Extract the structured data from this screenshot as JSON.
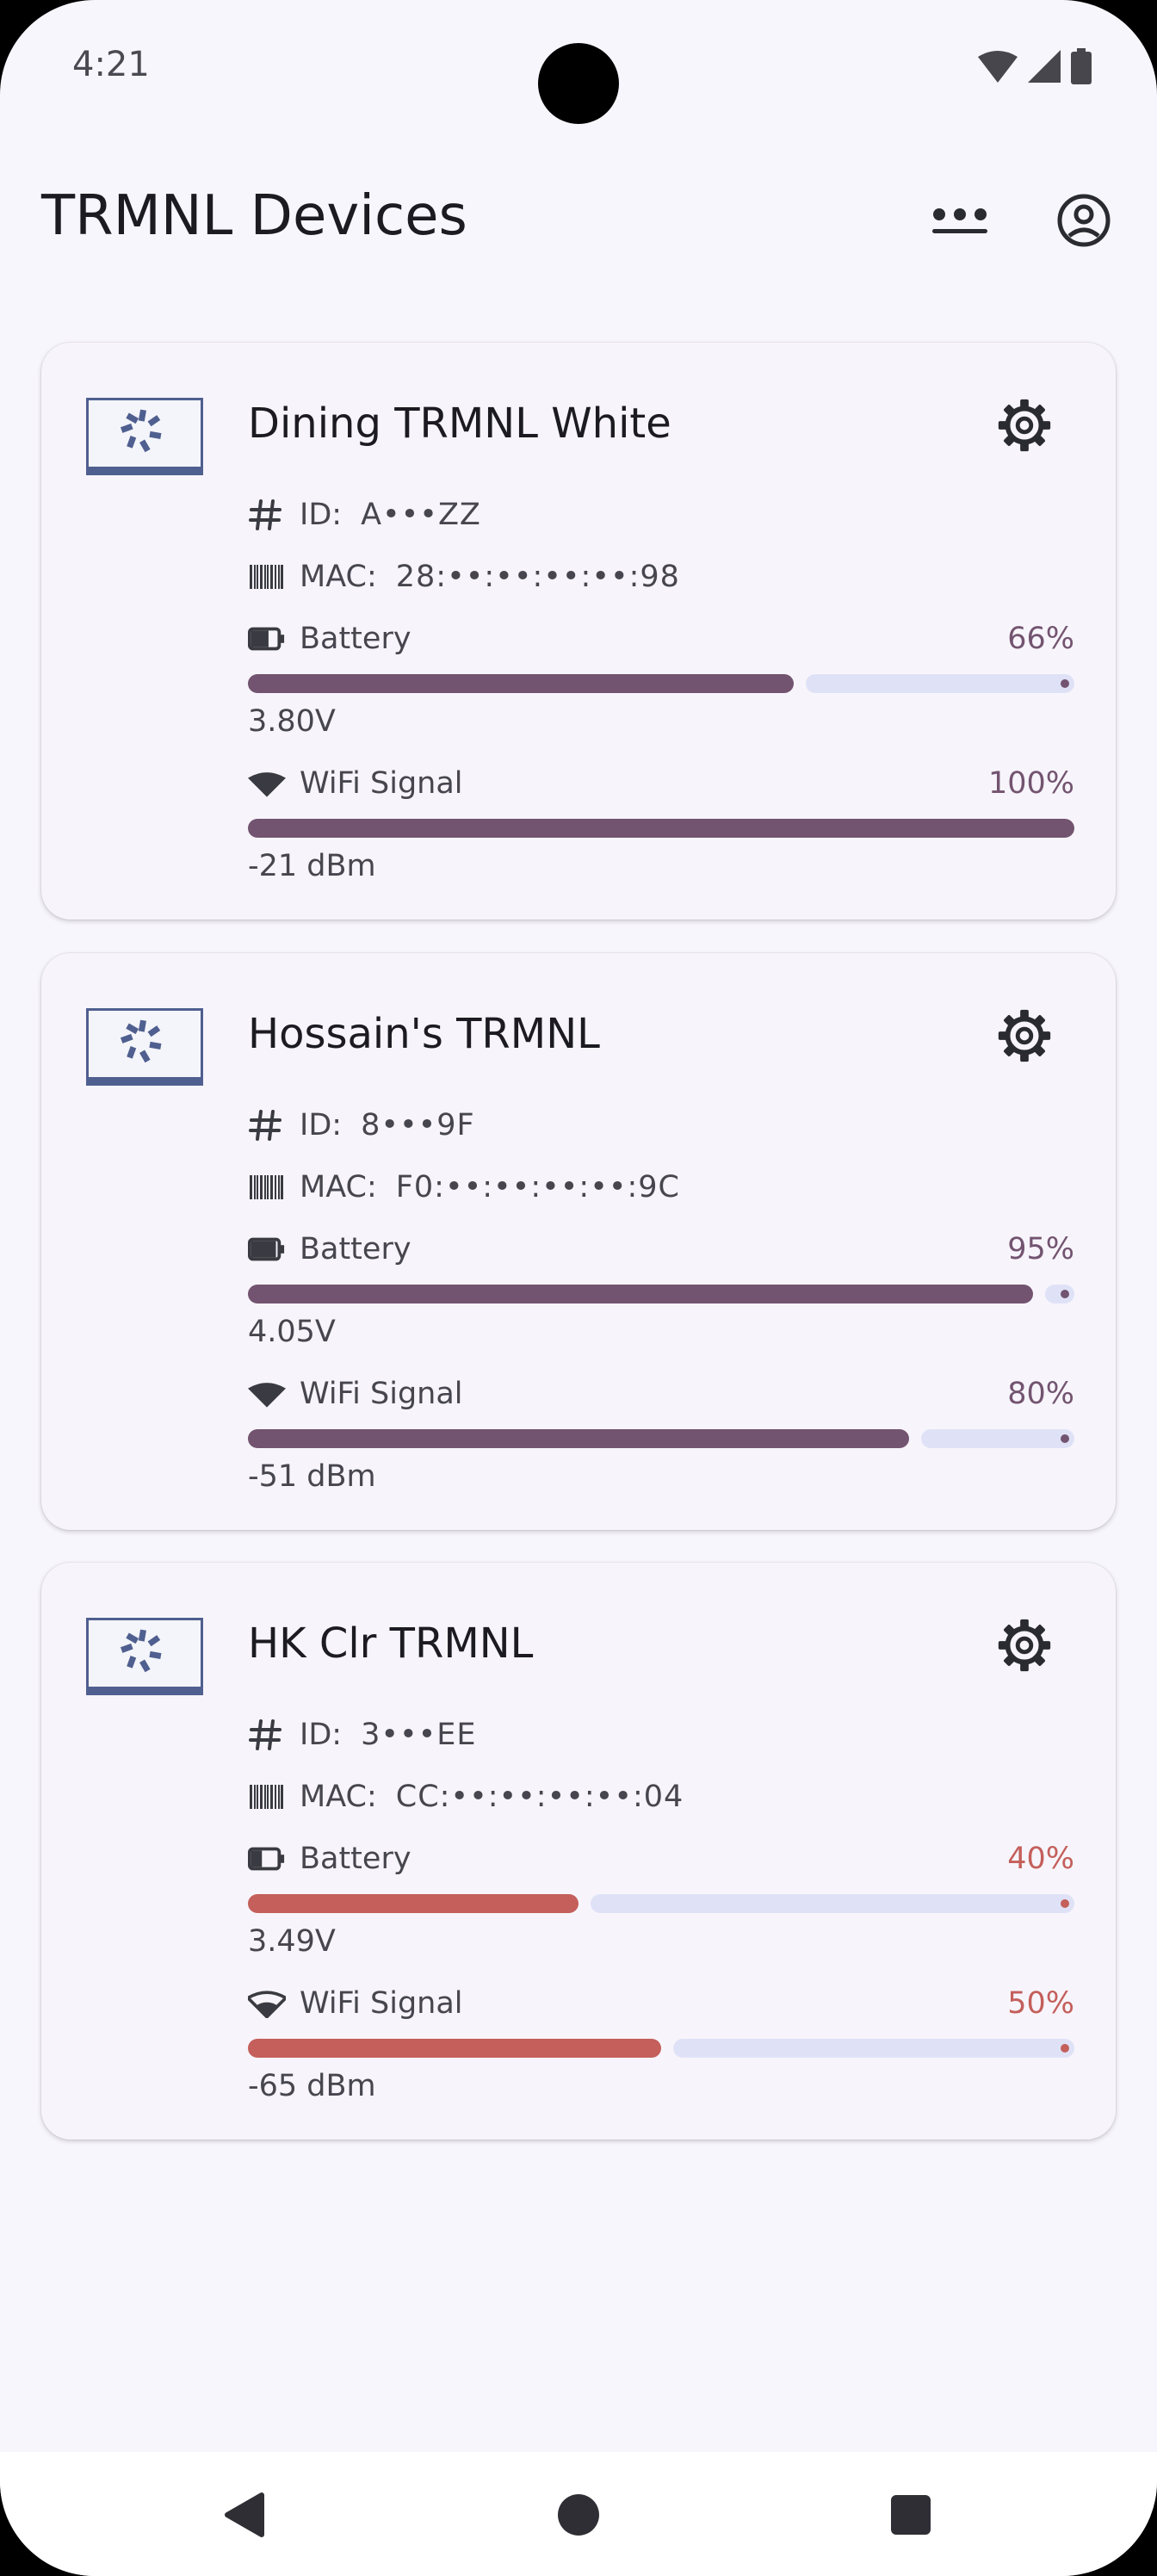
{
  "status_bar": {
    "time": "4:21"
  },
  "app_bar": {
    "title": "TRMNL Devices"
  },
  "colors": {
    "good": "#735470",
    "bad": "#c45f5b",
    "track": "#dfe2f7"
  },
  "labels": {
    "id": "ID:",
    "mac": "MAC:",
    "battery": "Battery",
    "wifi": "WiFi Signal"
  },
  "devices": [
    {
      "name": "Dining TRMNL White",
      "id": "A•••ZZ",
      "mac": "28:••:••:••:••:98",
      "battery_pct": "66%",
      "battery_value": 66,
      "voltage": "3.80V",
      "wifi_pct": "100%",
      "wifi_value": 100,
      "signal": "-21 dBm",
      "battery_status": "good",
      "wifi_status": "good",
      "battery_icon": "battery-half-icon",
      "wifi_icon": "wifi-full-icon"
    },
    {
      "name": "Hossain's TRMNL",
      "id": "8•••9F",
      "mac": "F0:••:••:••:••:9C",
      "battery_pct": "95%",
      "battery_value": 95,
      "voltage": "4.05V",
      "wifi_pct": "80%",
      "wifi_value": 80,
      "signal": "-51 dBm",
      "battery_status": "good",
      "wifi_status": "good",
      "battery_icon": "battery-full-icon",
      "wifi_icon": "wifi-full-icon"
    },
    {
      "name": "HK Clr TRMNL",
      "id": "3•••EE",
      "mac": "CC:••:••:••:••:04",
      "battery_pct": "40%",
      "battery_value": 40,
      "voltage": "3.49V",
      "wifi_pct": "50%",
      "wifi_value": 50,
      "signal": "-65 dBm",
      "battery_status": "bad",
      "wifi_status": "bad",
      "battery_icon": "battery-low-icon",
      "wifi_icon": "wifi-medium-icon"
    }
  ]
}
